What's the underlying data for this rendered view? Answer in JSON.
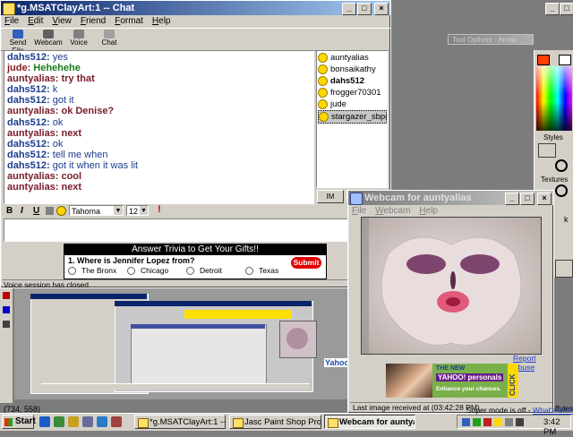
{
  "chat_window": {
    "title": "*g.MSATClayArt:1 -- Chat",
    "menu": [
      "File",
      "Edit",
      "View",
      "Friend",
      "Format",
      "Help"
    ],
    "toolbar": [
      {
        "label": "Send File",
        "icon": "send-file-icon"
      },
      {
        "label": "Webcam",
        "icon": "webcam-icon"
      },
      {
        "label": "Voice",
        "icon": "voice-icon"
      },
      {
        "label": "Chat",
        "icon": "chat-icon"
      }
    ],
    "messages": [
      {
        "nick": "dahs512:",
        "text": "yes",
        "nick_color": "#1c3c8c",
        "text_color": "#1c3c8c",
        "text_bold": false
      },
      {
        "nick": "jude:",
        "text": "Hehehehe",
        "nick_color": "#8a1a1a",
        "text_color": "#1a7a1a",
        "text_bold": true
      },
      {
        "nick": "auntyalias:",
        "text": "try that",
        "nick_color": "#7a1a2a",
        "text_color": "#7a1a2a",
        "text_bold": true
      },
      {
        "nick": "dahs512:",
        "text": "k",
        "nick_color": "#1c3c8c",
        "text_color": "#1c3c8c",
        "text_bold": false
      },
      {
        "nick": "dahs512:",
        "text": "got it",
        "nick_color": "#1c3c8c",
        "text_color": "#1c3c8c",
        "text_bold": false
      },
      {
        "nick": "auntyalias:",
        "text": "ok Denise?",
        "nick_color": "#7a1a2a",
        "text_color": "#7a1a2a",
        "text_bold": true
      },
      {
        "nick": "dahs512:",
        "text": "ok",
        "nick_color": "#1c3c8c",
        "text_color": "#1c3c8c",
        "text_bold": false
      },
      {
        "nick": "auntyalias:",
        "text": "next",
        "nick_color": "#7a1a2a",
        "text_color": "#7a1a2a",
        "text_bold": true
      },
      {
        "nick": "dahs512:",
        "text": "ok",
        "nick_color": "#1c3c8c",
        "text_color": "#1c3c8c",
        "text_bold": false
      },
      {
        "nick": "dahs512:",
        "text": "tell me when",
        "nick_color": "#1c3c8c",
        "text_color": "#1c3c8c",
        "text_bold": false
      },
      {
        "nick": "dahs512:",
        "text": "got it when it was lit",
        "nick_color": "#1c3c8c",
        "text_color": "#1c3c8c",
        "text_bold": false
      },
      {
        "nick": "auntyalias:",
        "text": "cool",
        "nick_color": "#7a1a2a",
        "text_color": "#7a1a2a",
        "text_bold": true
      },
      {
        "nick": "auntyalias:",
        "text": "next",
        "nick_color": "#7a1a2a",
        "text_color": "#7a1a2a",
        "text_bold": true
      }
    ],
    "buddies": [
      {
        "name": "auntyalias",
        "bold": false,
        "selected": false
      },
      {
        "name": "bonsaikathy",
        "bold": false,
        "selected": false
      },
      {
        "name": "dahs512",
        "bold": true,
        "selected": false
      },
      {
        "name": "frogger70301",
        "bold": false,
        "selected": false
      },
      {
        "name": "jude",
        "bold": false,
        "selected": false
      },
      {
        "name": "stargazer_sbpcg",
        "bold": false,
        "selected": true
      }
    ],
    "im_button": "IM",
    "format": {
      "bold": "B",
      "italic": "I",
      "underline": "U",
      "font": "Tahoma",
      "size": "12",
      "alert": "!"
    },
    "ad": {
      "headline": "Answer Trivia to Get Your Gifts!!",
      "question": "1. Where is Jennifer Lopez from?",
      "options": [
        "The Bronx",
        "Chicago",
        "Detroit",
        "Texas"
      ],
      "submit": "Submit"
    },
    "status": "Voice session has closed"
  },
  "tool_options": {
    "title": "Tool Options - Arrow"
  },
  "right_panel": {
    "styles": "Styles",
    "textures": "Textures",
    "bytes": "Bytes",
    "k": "k"
  },
  "webcam_window": {
    "title": "Webcam for auntyalias",
    "menu": [
      "File",
      "Webcam",
      "Help"
    ],
    "report_abuse": "Report Abuse",
    "ad": {
      "the_new": "THE NEW",
      "brand": "YAHOO! personals",
      "tagline": "Enhance your chances.",
      "click": "CLICK"
    },
    "status": "Last image received at (03:42:28 PM)"
  },
  "psp_status": {
    "coords": "(734, 558)"
  },
  "background_thumb": {
    "yahoo_text": "Yahoo"
  },
  "taskbar": {
    "start": "Start",
    "buttons": [
      {
        "label": "*g.MSATClayArt:1 -- Chat",
        "pressed": false
      },
      {
        "label": "Jasc Paint Shop Pro - Ima...",
        "pressed": false
      },
      {
        "label": "Webcam for auntyalias",
        "pressed": true
      }
    ],
    "super_mode": "Super mode is off -",
    "whats_this": "What's this?",
    "clock": "3:42 PM"
  },
  "colors": {
    "title_active": "#0a246a",
    "desktop": "#808080",
    "chat_ad_red": "#e00000"
  }
}
